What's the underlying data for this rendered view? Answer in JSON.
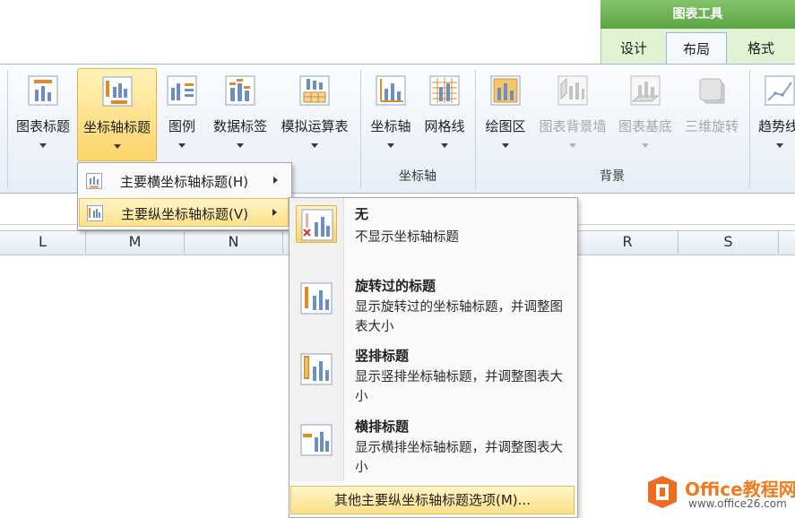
{
  "context_tabs": {
    "group_title": "图表工具",
    "tabs": [
      {
        "label": "设计",
        "active": false
      },
      {
        "label": "布局",
        "active": true
      },
      {
        "label": "格式",
        "active": false
      }
    ]
  },
  "ribbon": {
    "buttons": [
      {
        "label": "图表标题",
        "icon": "chart-title-icon",
        "state": "normal"
      },
      {
        "label": "坐标轴标题",
        "icon": "axis-title-icon",
        "state": "active"
      },
      {
        "label": "图例",
        "icon": "legend-icon",
        "state": "normal"
      },
      {
        "label": "数据标签",
        "icon": "data-labels-icon",
        "state": "normal"
      },
      {
        "label": "模拟运算表",
        "icon": "data-table-icon",
        "state": "normal"
      },
      {
        "label": "坐标轴",
        "icon": "axes-icon",
        "state": "normal"
      },
      {
        "label": "网格线",
        "icon": "gridlines-icon",
        "state": "normal"
      },
      {
        "label": "绘图区",
        "icon": "plot-area-icon",
        "state": "normal"
      },
      {
        "label": "图表背景墙",
        "icon": "chart-wall-icon",
        "state": "disabled"
      },
      {
        "label": "图表基底",
        "icon": "chart-floor-icon",
        "state": "disabled"
      },
      {
        "label": "三维旋转",
        "icon": "3d-rotation-icon",
        "state": "disabled"
      },
      {
        "label": "趋势线",
        "icon": "trendline-icon",
        "state": "normal"
      }
    ],
    "groups": {
      "axes": "坐标轴",
      "background": "背景"
    }
  },
  "sheet": {
    "columns": [
      "L",
      "M",
      "N",
      "R",
      "S"
    ]
  },
  "axis_title_menu": {
    "items": [
      {
        "label": "主要横坐标轴标题(H)",
        "icon": "horizontal-axis-title-icon",
        "active": false
      },
      {
        "label": "主要纵坐标轴标题(V)",
        "icon": "vertical-axis-title-icon",
        "active": true
      }
    ]
  },
  "vertical_title_menu": {
    "options": [
      {
        "title": "无",
        "description": "不显示坐标轴标题",
        "icon": "no-axis-title-icon",
        "selected": true
      },
      {
        "title": "旋转过的标题",
        "description": "显示旋转过的坐标轴标题，并调整图表大小",
        "icon": "rotated-title-icon",
        "selected": false
      },
      {
        "title": "竖排标题",
        "description": "显示竖排坐标轴标题，并调整图表大小",
        "icon": "vertical-title-icon",
        "selected": false
      },
      {
        "title": "横排标题",
        "description": "显示横排坐标轴标题，并调整图表大小",
        "icon": "horizontal-title-icon",
        "selected": false
      }
    ],
    "more_options": "其他主要纵坐标轴标题选项(M)..."
  },
  "watermark": {
    "brand": "Office教程网",
    "url": "www.office26.com"
  },
  "colors": {
    "context_green": "#5aa543",
    "highlight_gold": "#fcd46a",
    "ribbon_border": "#9bb7d6",
    "disabled_text": "#a7a7a7"
  }
}
